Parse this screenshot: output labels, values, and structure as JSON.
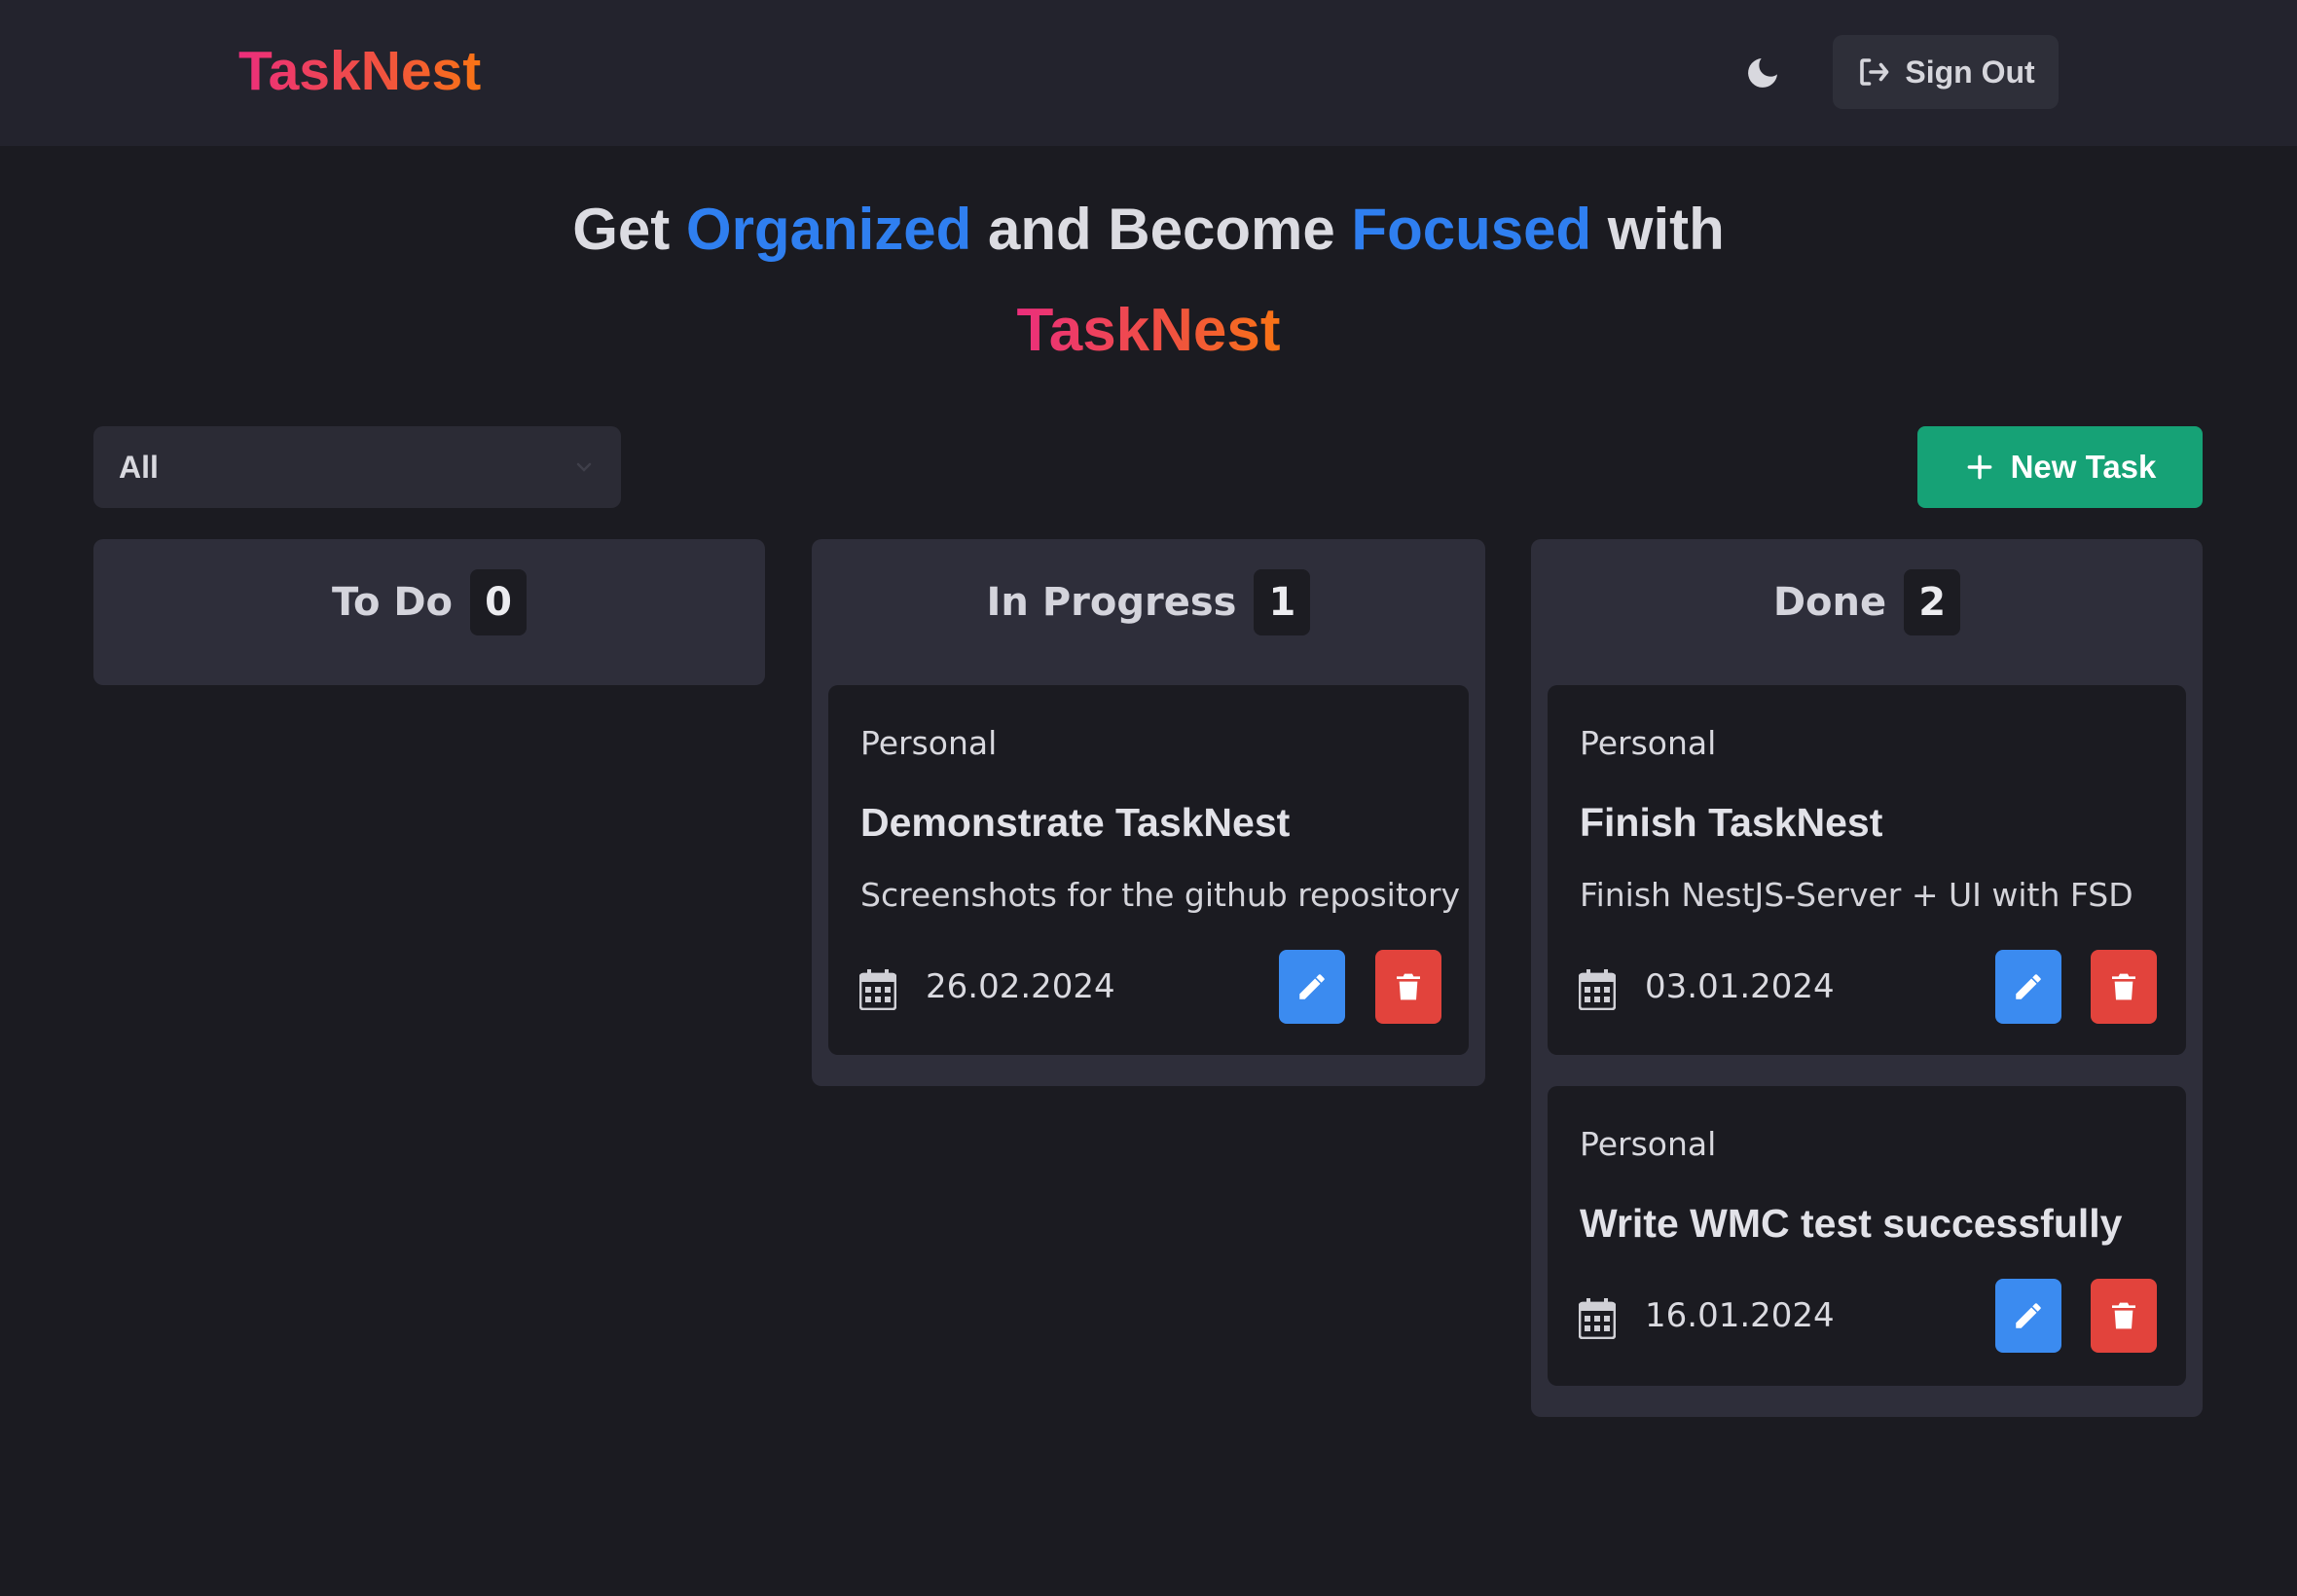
{
  "nav": {
    "brand": "TaskNest",
    "theme_icon": "moon-icon",
    "sign_out_label": "Sign Out",
    "sign_out_icon": "sign-out-icon"
  },
  "hero": {
    "part1": "Get ",
    "highlight1": "Organized",
    "part2": " and Become ",
    "highlight2": "Focused",
    "part3": " with",
    "brand": "TaskNest"
  },
  "filter": {
    "selected": "All",
    "icon": "chevron-down-icon"
  },
  "new_task": {
    "label": "New Task",
    "icon": "plus-icon"
  },
  "columns": [
    {
      "title": "To Do",
      "count": "0"
    },
    {
      "title": "In Progress",
      "count": "1"
    },
    {
      "title": "Done",
      "count": "2"
    }
  ],
  "cards": [
    {
      "category": "Personal",
      "title": "Demonstrate TaskNest",
      "description": "Screenshots for the github repository",
      "date": "26.02.2024"
    },
    {
      "category": "Personal",
      "title": "Finish TaskNest",
      "description": "Finish NestJS-Server + UI with FSD",
      "date": "03.01.2024"
    },
    {
      "category": "Personal",
      "title": "Write WMC test successfully",
      "description": "",
      "date": "16.01.2024"
    }
  ],
  "colors": {
    "accent_blue": "#2f7ff0",
    "brand_gradient_start": "#ec2e7c",
    "brand_gradient_end": "#f97415",
    "new_task_green": "#16a276",
    "edit_blue": "#3b8bf0",
    "delete_red": "#e2433c",
    "background": "#1b1b21",
    "navbar": "#23232d",
    "column_bg": "#2e2e3a"
  }
}
